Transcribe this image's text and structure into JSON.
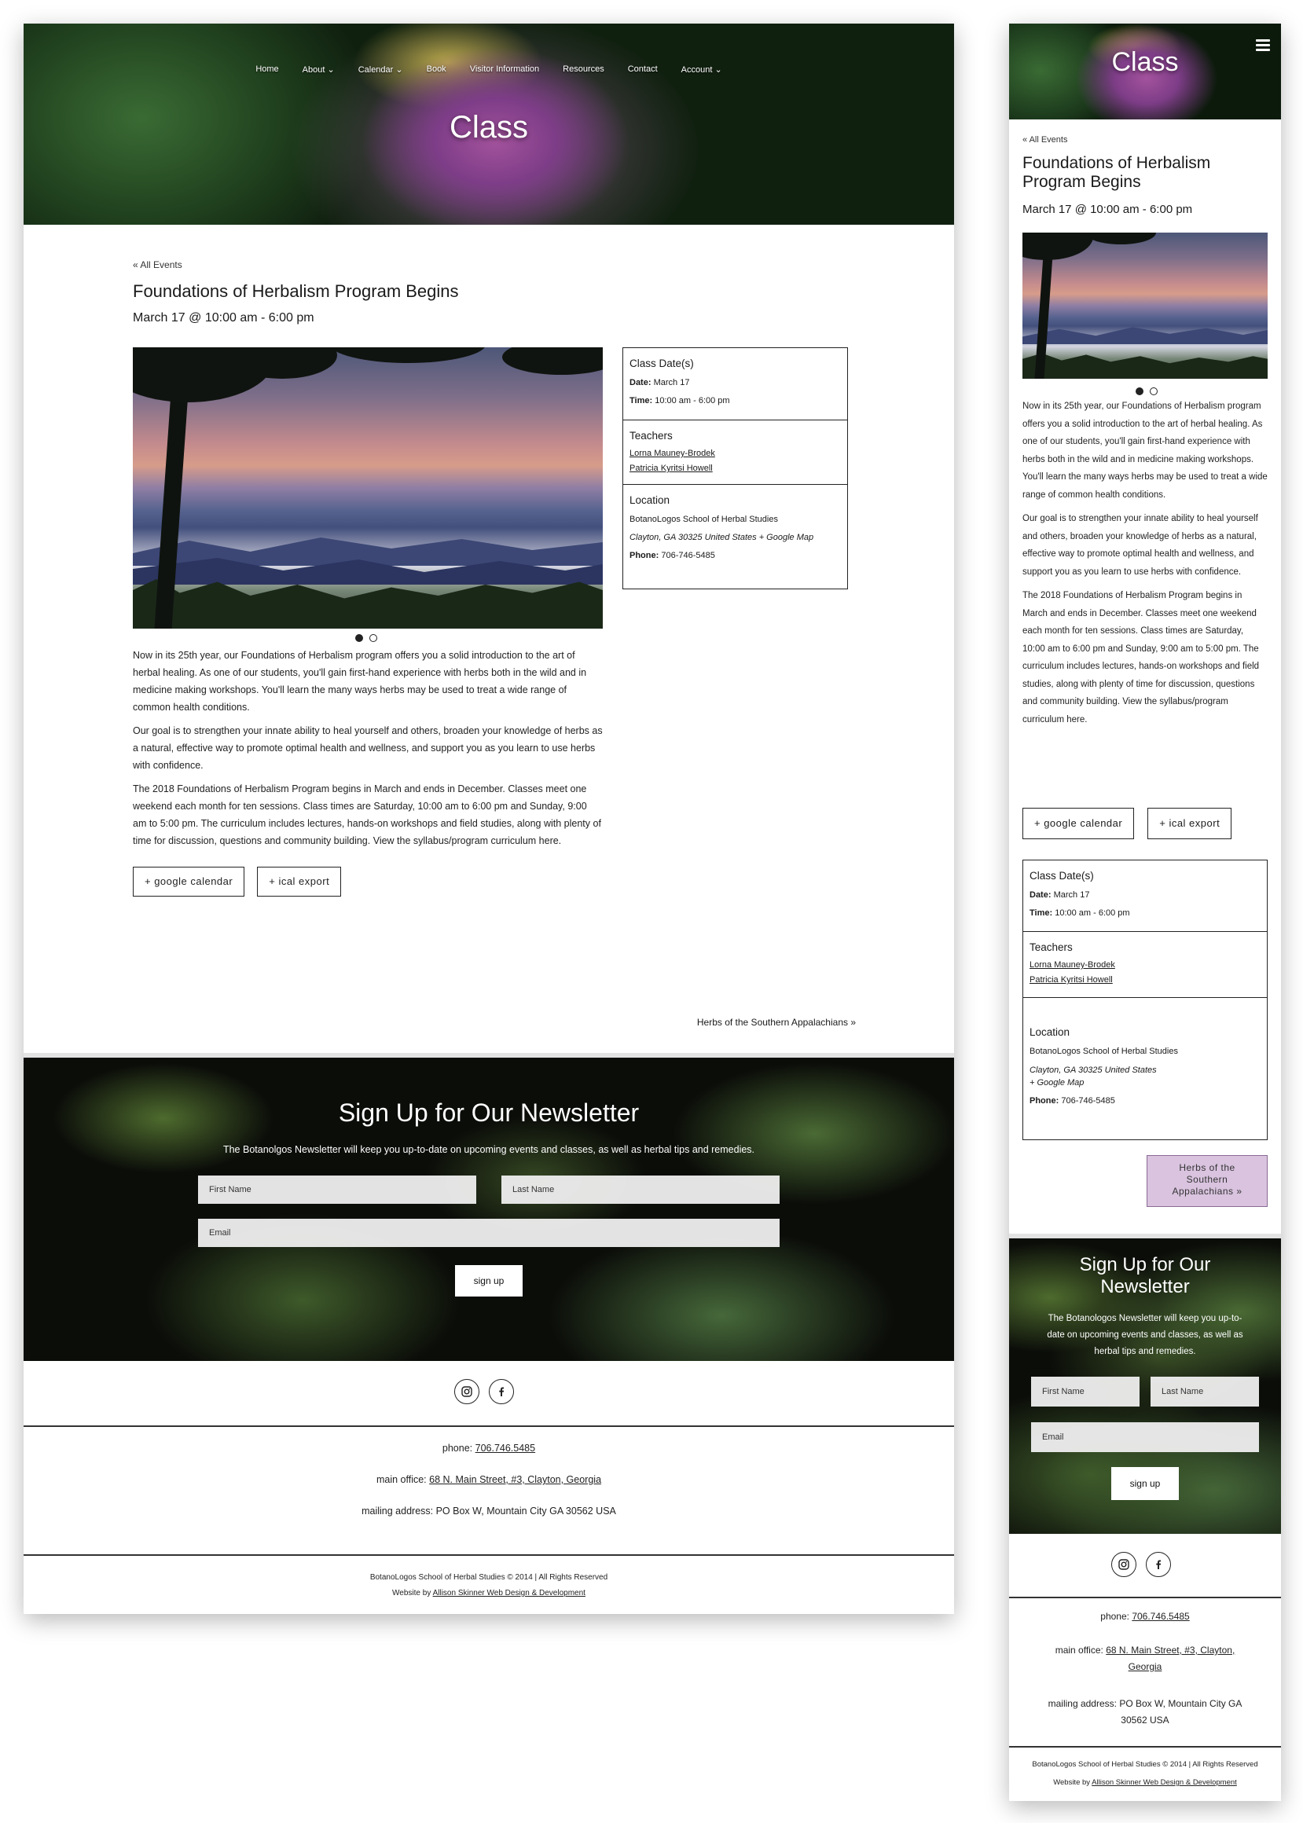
{
  "site": {
    "hero_title": "Class",
    "nav": [
      {
        "label": "Home",
        "has_dropdown": false
      },
      {
        "label": "About",
        "has_dropdown": true
      },
      {
        "label": "Calendar",
        "has_dropdown": true
      },
      {
        "label": "Book",
        "has_dropdown": false
      },
      {
        "label": "Visitor Information",
        "has_dropdown": false
      },
      {
        "label": "Resources",
        "has_dropdown": false
      },
      {
        "label": "Contact",
        "has_dropdown": false
      },
      {
        "label": "Account",
        "has_dropdown": true
      }
    ],
    "dropdown_glyph": "⌄"
  },
  "event": {
    "back_link": "« All Events",
    "title": "Foundations of Herbalism Program Begins",
    "title_mobile": [
      "Foundations of Herbalism",
      "Program Begins"
    ],
    "datetime": "March 17 @ 10:00 am - 6:00 pm",
    "slides": 2,
    "active_slide": 0,
    "body": [
      "Now in its 25th year, our Foundations of Herbalism program offers you a solid introduction to the art of herbal healing. As one of our students, you'll gain first-hand experience with herbs both in the wild and in medicine making workshops. You'll learn the many ways herbs may be used to treat a wide range of common health conditions.",
      "Our goal is to strengthen your innate ability to heal yourself and others, broaden your knowledge of herbs as a natural, effective way to promote optimal health and wellness, and support you as you learn to use herbs with confidence.",
      "The 2018 Foundations of Herbalism Program begins in March and ends in December. Classes meet one weekend each month for ten sessions. Class times are Saturday, 10:00 am to 6:00 pm and Sunday, 9:00 am to 5:00 pm. The curriculum includes lectures, hands-on workshops and field studies, along with plenty of time for discussion, questions and community building. View the syllabus/program curriculum here."
    ],
    "google_calendar": "+ google calendar",
    "ical_export": "+ ical export",
    "next_event": "Herbs of the Southern Appalachians »",
    "next_event_mobile": [
      "Herbs of the",
      "Southern",
      "Appalachians »"
    ]
  },
  "meta": {
    "dates_heading": "Class Date(s)",
    "date_label": "Date:",
    "date_value": "March 17",
    "time_label": "Time:",
    "time_value": "10:00 am - 6:00 pm",
    "teachers_heading": "Teachers",
    "teachers": [
      "Lorna Mauney-Brodek",
      "Patricia Kyritsi Howell"
    ],
    "location_heading": "Location",
    "venue": "BotanoLogos School of Herbal Studies",
    "address": "Clayton, GA 30325 United States",
    "map_link": "+ Google Map",
    "phone_label": "Phone:",
    "phone_value": "706-746-5485"
  },
  "newsletter": {
    "title": "Sign Up for Our Newsletter",
    "title_mobile": [
      "Sign Up for Our",
      "Newsletter"
    ],
    "description": "The Botanolgos Newsletter will keep you up-to-date on upcoming events and classes, as well as herbal tips and remedies.",
    "description_mobile": [
      "The Botanologos Newsletter will keep you up-to-",
      "date on upcoming events and classes, as well as",
      "herbal tips and remedies."
    ],
    "first_name_placeholder": "First Name",
    "last_name_placeholder": "Last Name",
    "email_placeholder": "Email",
    "button": "sign up"
  },
  "social": [
    "instagram-icon",
    "facebook-icon"
  ],
  "footer": {
    "phone_label": "phone:",
    "phone_value": "706.746.5485",
    "office_label": "main office:",
    "office_value": "68 N. Main Street, #3, Clayton, Georgia",
    "office_value_mobile": [
      "68 N. Main Street, #3, Clayton,",
      "Georgia"
    ],
    "mailing": "mailing address: PO Box W, Mountain City GA 30562 USA",
    "mailing_mobile": [
      "mailing address: PO Box W, Mountain City GA",
      "30562 USA"
    ],
    "copyright": "BotanoLogos School of Herbal Studies © 2014 | All Rights Reserved",
    "credit_prefix": "Website by",
    "credit_link": "Allison Skinner Web Design & Development"
  },
  "colors": {
    "next_event_bg": "#d9c3df",
    "text": "#1a1a1a"
  }
}
